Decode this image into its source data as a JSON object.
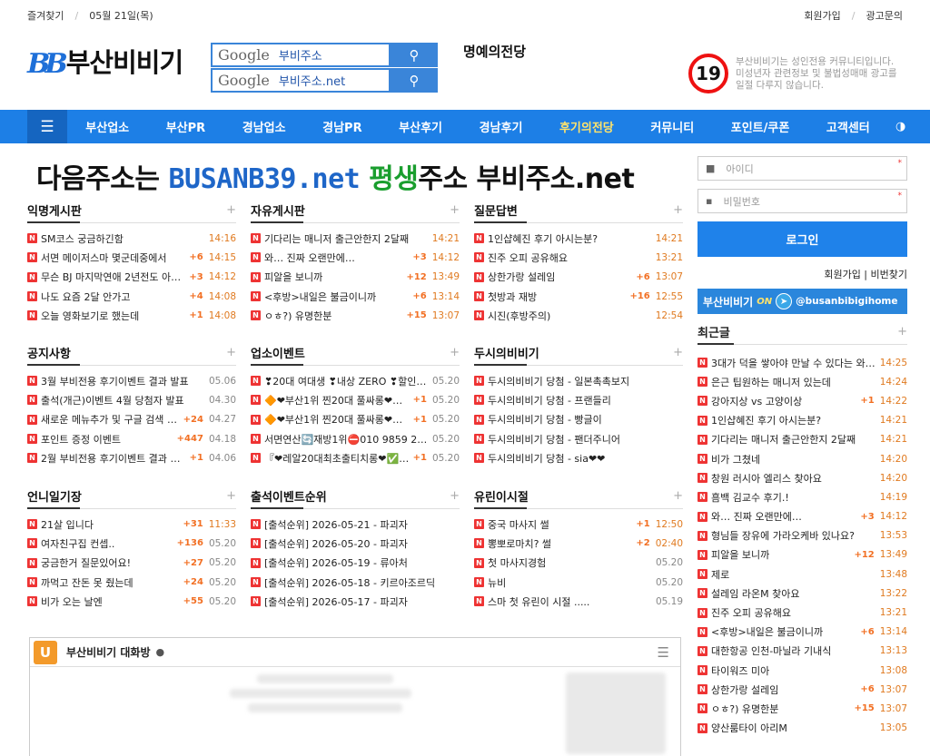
{
  "topbar": {
    "favorites": "즐겨찾기",
    "date": "05월 21일(목)",
    "signup": "회원가입",
    "ad": "광고문의"
  },
  "header": {
    "logo_bb": "BB",
    "logo_text": "부산비비기",
    "search1": "부비주소",
    "search2": "부비주소.net",
    "google": "Google",
    "hall": "명예의전당",
    "age": "19",
    "notice1": "부산비비기는 성인전용 커뮤니티입니다.",
    "notice2": "미성년자 관련정보 및 불법성매매 광고를",
    "notice3": "일절 다루지 않습니다."
  },
  "nav": [
    "부산업소",
    "부산PR",
    "경남업소",
    "경남PR",
    "부산후기",
    "경남후기",
    "후기의전당",
    "커뮤니티",
    "포인트/쿠폰",
    "고객센터"
  ],
  "banner": {
    "p1": "다음주소는 ",
    "p2": "BUSANB39.net",
    "p3": " 평생",
    "p4": "주소 부비주소.net"
  },
  "boards": [
    {
      "title": "익명게시판",
      "items": [
        {
          "t": "SM코스 궁금하긴함",
          "c": "",
          "d": "14:16"
        },
        {
          "t": "서면 메이저스마 몇군데중에서",
          "c": "+6",
          "d": "14:15"
        },
        {
          "t": "무슨 BJ 마지막연애 2년전도 아…",
          "c": "+3",
          "d": "14:12"
        },
        {
          "t": "나도 요즘 2달 안가고",
          "c": "+4",
          "d": "14:08"
        },
        {
          "t": "오늘 영화보기로 했는데",
          "c": "+1",
          "d": "14:08"
        }
      ]
    },
    {
      "title": "자유게시판",
      "items": [
        {
          "t": "기다리는 매니저 출근안한지 2달째",
          "c": "",
          "d": "14:21"
        },
        {
          "t": "와… 진짜 오랜만에…",
          "c": "+3",
          "d": "14:12"
        },
        {
          "t": "피알을 보니까",
          "c": "+12",
          "d": "13:49"
        },
        {
          "t": "<후방>내일은 불금이니까",
          "c": "+6",
          "d": "13:14"
        },
        {
          "t": "ㅇㅎ?) 유명한분",
          "c": "+15",
          "d": "13:07"
        }
      ]
    },
    {
      "title": "질문답변",
      "items": [
        {
          "t": "1인샵혜진 후기 아시는분?",
          "c": "",
          "d": "14:21"
        },
        {
          "t": "진주 오피 공유해요",
          "c": "",
          "d": "13:21"
        },
        {
          "t": "상한가랑 설레임",
          "c": "+6",
          "d": "13:07"
        },
        {
          "t": "첫방과 재방",
          "c": "+16",
          "d": "12:55"
        },
        {
          "t": "시진(후방주의)",
          "c": "",
          "d": "12:54"
        }
      ]
    },
    {
      "title": "공지사항",
      "items": [
        {
          "t": "3월 부비전용 후기이벤트 결과 발표",
          "c": "",
          "d": "05.06"
        },
        {
          "t": "출석(개근)이벤트 4월 당첨자 발표",
          "c": "",
          "d": "04.30"
        },
        {
          "t": "새로운 메뉴추가 및 구글 검색 키…",
          "c": "+24",
          "d": "04.27"
        },
        {
          "t": "포인트 증정 이벤트",
          "c": "+447",
          "d": "04.18"
        },
        {
          "t": "2월 부비전용 후기이벤트 결과 발표",
          "c": "+1",
          "d": "04.06"
        }
      ]
    },
    {
      "title": "업소이벤트",
      "items": [
        {
          "t": "❣20대 여대생 ❣내상 ZERO ❣할인…",
          "c": "",
          "d": "05.20"
        },
        {
          "t": "🔶❤부산1위 찐20대 풀싸롱❤…",
          "c": "+1",
          "d": "05.20"
        },
        {
          "t": "🔶❤부산1위 찐20대 풀싸롱❤…",
          "c": "+1",
          "d": "05.20"
        },
        {
          "t": "서면연산🔄재방1위⛔010 9859 2462…",
          "c": "",
          "d": "05.20"
        },
        {
          "t": "『❤레알20대최초출티치롱❤✅부…",
          "c": "+1",
          "d": "05.20"
        }
      ]
    },
    {
      "title": "두시의비비기",
      "items": [
        {
          "t": "두시의비비기 당첨 - 일본촉촉보지",
          "c": "",
          "d": ""
        },
        {
          "t": "두시의비비기 당첨 - 프랜들리",
          "c": "",
          "d": ""
        },
        {
          "t": "두시의비비기 당첨 - 빵글이",
          "c": "",
          "d": ""
        },
        {
          "t": "두시의비비기 당첨 - 팬더주니어",
          "c": "",
          "d": ""
        },
        {
          "t": "두시의비비기 당첨 - sia❤❤",
          "c": "",
          "d": ""
        }
      ]
    },
    {
      "title": "언니일기장",
      "items": [
        {
          "t": "21살 입니다",
          "c": "+31",
          "d": "11:33"
        },
        {
          "t": "여자친구집 컨셉..",
          "c": "+136",
          "d": "05.20"
        },
        {
          "t": "궁금한거 질문있어요!",
          "c": "+27",
          "d": "05.20"
        },
        {
          "t": "까먹고 잔돈 못 줬는데",
          "c": "+24",
          "d": "05.20"
        },
        {
          "t": "비가 오는 날엔",
          "c": "+55",
          "d": "05.20"
        }
      ]
    },
    {
      "title": "출석이벤트순위",
      "items": [
        {
          "t": "[출석순위] 2026-05-21 - 파괴자",
          "c": "",
          "d": ""
        },
        {
          "t": "[출석순위] 2026-05-20 - 파괴자",
          "c": "",
          "d": ""
        },
        {
          "t": "[출석순위] 2026-05-19 - 류아처",
          "c": "",
          "d": ""
        },
        {
          "t": "[출석순위] 2026-05-18 - 키르아조르딕",
          "c": "",
          "d": ""
        },
        {
          "t": "[출석순위] 2026-05-17 - 파괴자",
          "c": "",
          "d": ""
        }
      ]
    },
    {
      "title": "유린이시절",
      "items": [
        {
          "t": "중국 마사지 썰",
          "c": "+1",
          "d": "12:50"
        },
        {
          "t": "뽕뽀로마치? 썰",
          "c": "+2",
          "d": "02:40"
        },
        {
          "t": "첫 마사지경험",
          "c": "",
          "d": "05.20"
        },
        {
          "t": "뉴비",
          "c": "",
          "d": "05.20"
        },
        {
          "t": "스마 첫 유린이 시절 .....",
          "c": "",
          "d": "05.19"
        }
      ]
    }
  ],
  "more": "+",
  "chat": {
    "u": "U",
    "title": "부산비비기 대화방",
    "hamburger": "☰"
  },
  "login": {
    "id_placeholder": "아이디",
    "pw_placeholder": "비밀번호",
    "button": "로그인",
    "signup": "회원가입",
    "find_pw": "비번찾기",
    "tg_main": "부산비비기",
    "tg_on": "ON",
    "tg_handle": "@busanbibigihome"
  },
  "recent": {
    "title": "최근글",
    "items": [
      {
        "t": "3대가 덕을 쌓아야 만날 수 있다는 와…",
        "c": "",
        "d": "14:25"
      },
      {
        "t": "은근 팁원하는 매니저 있는데",
        "c": "",
        "d": "14:24"
      },
      {
        "t": "강아지상 vs 고양이상",
        "c": "+1",
        "d": "14:22"
      },
      {
        "t": "1인샵혜진 후기 아시는분?",
        "c": "",
        "d": "14:21"
      },
      {
        "t": "기다리는 매니저 출근안한지 2달째",
        "c": "",
        "d": "14:21"
      },
      {
        "t": "비가 그쳤네",
        "c": "",
        "d": "14:20"
      },
      {
        "t": "창원 러시아 엘리스 찾아요",
        "c": "",
        "d": "14:20"
      },
      {
        "t": "흠백 김교수 후기.!",
        "c": "",
        "d": "14:19"
      },
      {
        "t": "와… 진짜 오랜만에…",
        "c": "+3",
        "d": "14:12"
      },
      {
        "t": "형님들 장유에 가라오케바 있나요?",
        "c": "",
        "d": "13:53"
      },
      {
        "t": "피알을 보니까",
        "c": "+12",
        "d": "13:49"
      },
      {
        "t": "제로",
        "c": "",
        "d": "13:48"
      },
      {
        "t": "설레임 라온M 찾아요",
        "c": "",
        "d": "13:22"
      },
      {
        "t": "진주 오피 공유해요",
        "c": "",
        "d": "13:21"
      },
      {
        "t": "<후방>내일은 불금이니까",
        "c": "+6",
        "d": "13:14"
      },
      {
        "t": "대한항공 인천-마닐라 기내식",
        "c": "",
        "d": "13:13"
      },
      {
        "t": "타이워즈 미아",
        "c": "",
        "d": "13:08"
      },
      {
        "t": "상한가랑 설레임",
        "c": "+6",
        "d": "13:07"
      },
      {
        "t": "ㅇㅎ?) 유명한분",
        "c": "+15",
        "d": "13:07"
      },
      {
        "t": "양산룸타이 아리M",
        "c": "",
        "d": "13:05"
      }
    ]
  }
}
